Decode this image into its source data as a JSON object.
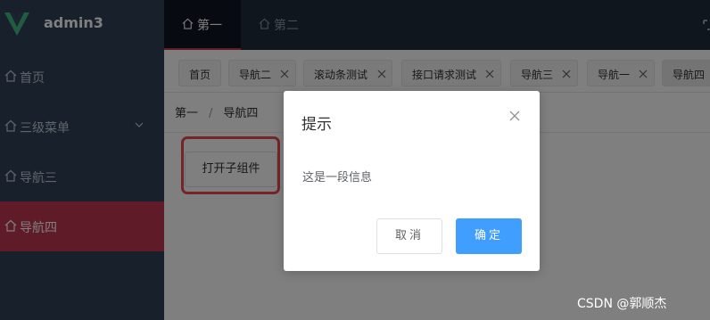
{
  "app": {
    "title": "admin3"
  },
  "sidebar": {
    "items": [
      {
        "label": "首页"
      },
      {
        "label": "三级菜单"
      },
      {
        "label": "导航三"
      },
      {
        "label": "导航四"
      }
    ],
    "active_index": 3
  },
  "header": {
    "tabs": [
      {
        "label": "第一"
      },
      {
        "label": "第二"
      }
    ],
    "active_index": 0
  },
  "tags": [
    {
      "label": "首页"
    },
    {
      "label": "导航二"
    },
    {
      "label": "滚动条测试"
    },
    {
      "label": "接口请求测试"
    },
    {
      "label": "导航三"
    },
    {
      "label": "导航一"
    },
    {
      "label": "导航四"
    }
  ],
  "breadcrumb": {
    "items": [
      "第一",
      "导航四"
    ],
    "separator": "/"
  },
  "main": {
    "open_child_label": "打开子组件"
  },
  "dialog": {
    "title": "提示",
    "message": "这是一段信息",
    "cancel_label": "取消",
    "confirm_label": "确定"
  },
  "watermark": "CSDN @郭顺杰",
  "colors": {
    "sidebar_bg": "#304156",
    "header_bg": "#1f2d3d",
    "active_menu": "#c03650",
    "primary": "#409eff",
    "highlight_border": "#e84a4a"
  }
}
